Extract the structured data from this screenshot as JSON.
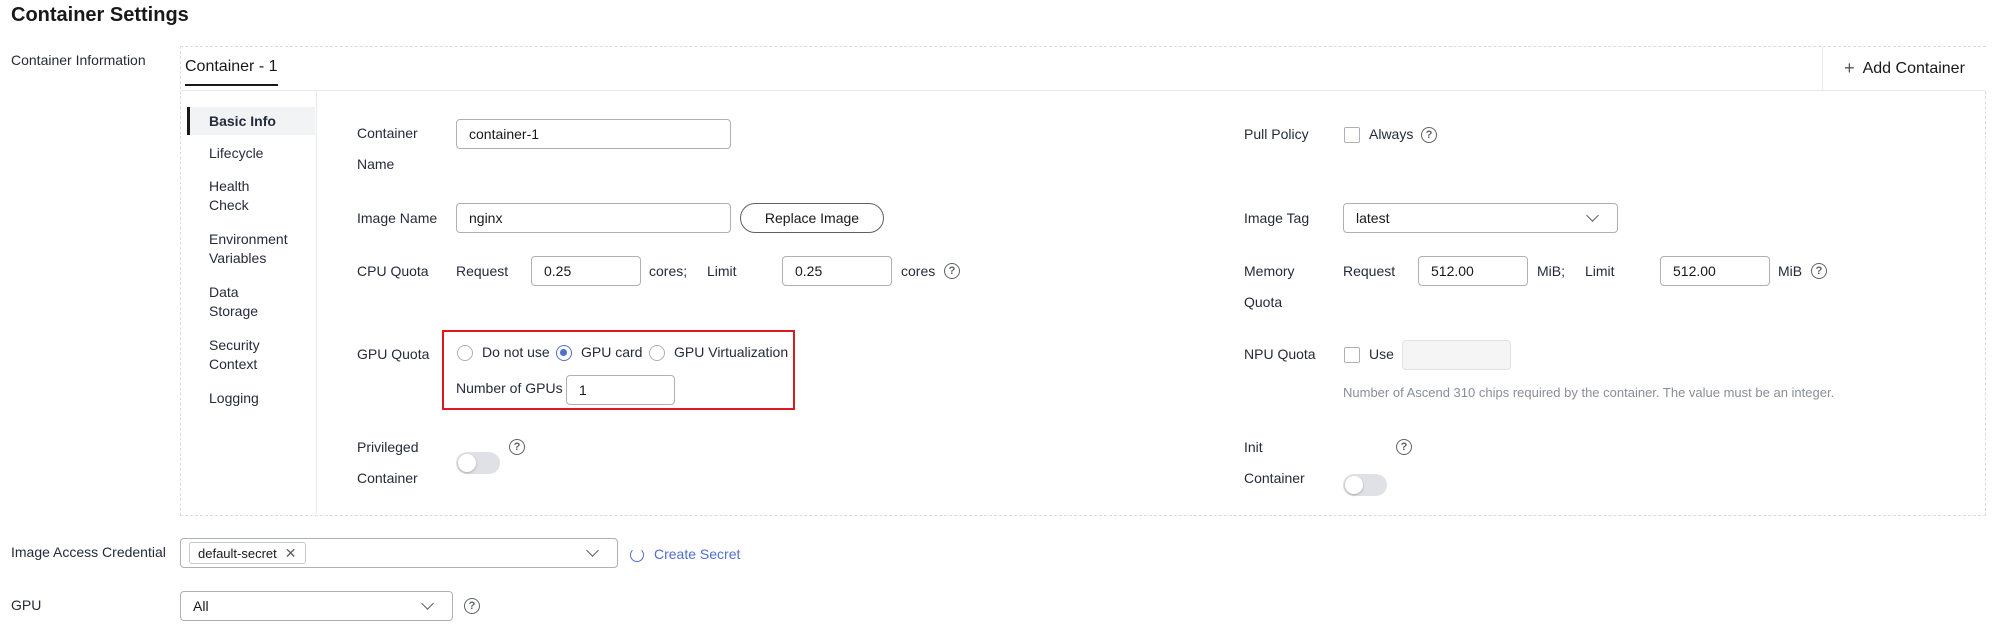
{
  "page": {
    "title": "Container Settings"
  },
  "sections": {
    "container_info_label": "Container Information",
    "image_credential_label": "Image Access Credential",
    "gpu_label": "GPU"
  },
  "tabs": {
    "active": "Container - 1",
    "add_label": "Add Container",
    "add_icon": "+"
  },
  "sidenav": [
    {
      "label": "Basic Info",
      "active": true
    },
    {
      "label": "Lifecycle"
    },
    {
      "label": "Health Check",
      "lines": [
        "Health",
        "Check"
      ]
    },
    {
      "label": "Environment Variables",
      "lines": [
        "Environment",
        "Variables"
      ]
    },
    {
      "label": "Data Storage",
      "lines": [
        "Data",
        "Storage"
      ]
    },
    {
      "label": "Security Context",
      "lines": [
        "Security",
        "Context"
      ]
    },
    {
      "label": "Logging"
    }
  ],
  "form": {
    "container_name": {
      "label_l1": "Container",
      "label_l2": "Name",
      "value": "container-1"
    },
    "pull_policy": {
      "label": "Pull Policy",
      "option": "Always",
      "checked": false
    },
    "image_name": {
      "label": "Image Name",
      "value": "nginx",
      "button": "Replace Image"
    },
    "image_tag": {
      "label": "Image Tag",
      "value": "latest"
    },
    "cpu_quota": {
      "label": "CPU Quota",
      "request_label": "Request",
      "request": "0.25",
      "request_unit": "cores;",
      "limit_label": "Limit",
      "limit": "0.25",
      "limit_unit": "cores"
    },
    "memory_quota": {
      "label_l1": "Memory",
      "label_l2": "Quota",
      "request_label": "Request",
      "request": "512.00",
      "request_unit": "MiB;",
      "limit_label": "Limit",
      "limit": "512.00",
      "limit_unit": "MiB"
    },
    "gpu_quota": {
      "label": "GPU Quota",
      "options": [
        "Do not use",
        "GPU card",
        "GPU Virtualization"
      ],
      "selected": "GPU card",
      "num_label": "Number of GPUs",
      "num_value": "1"
    },
    "npu_quota": {
      "label": "NPU Quota",
      "option": "Use",
      "checked": false,
      "hint": "Number of Ascend 310 chips required by the container. The value must be an integer."
    },
    "privileged": {
      "label_l1": "Privileged",
      "label_l2": "Container",
      "enabled": false
    },
    "init": {
      "label_l1": "Init",
      "label_l2": "Container",
      "enabled": false
    }
  },
  "credential": {
    "tag": "default-secret",
    "create_link": "Create Secret"
  },
  "gpu_select": {
    "value": "All"
  },
  "colors": {
    "accent": "#526ecc",
    "highlight_border": "#e0191f",
    "text": "#252b3a"
  },
  "icons": [
    "help-icon",
    "chevron-down-icon",
    "close-icon",
    "refresh-icon",
    "plus-icon"
  ]
}
